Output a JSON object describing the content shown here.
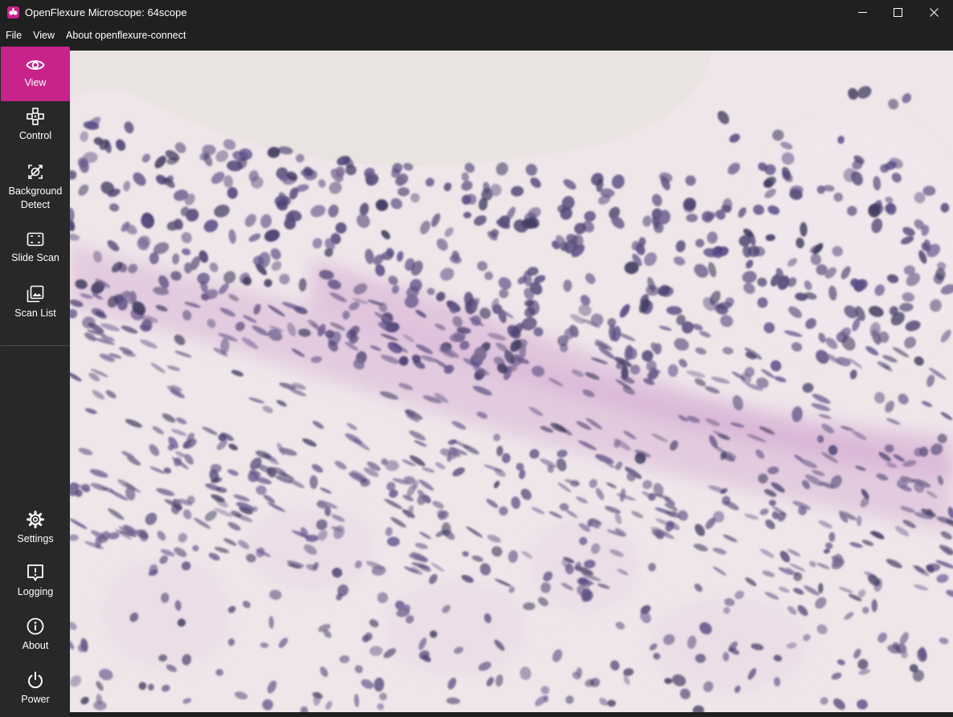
{
  "window": {
    "title": "OpenFlexure Microscope: 64scope",
    "app_icon": "openflexure-logo-icon",
    "controls": [
      "minimize-icon",
      "maximize-icon",
      "close-icon"
    ]
  },
  "menu": [
    "File",
    "View",
    "About openflexure-connect"
  ],
  "sidebar": {
    "top_items": [
      {
        "label": "View",
        "icon": "eye-icon",
        "active": true
      },
      {
        "label": "Control",
        "icon": "gamepad-icon",
        "active": false
      },
      {
        "label": "Background Detect",
        "icon": "background-detect-icon",
        "active": false
      },
      {
        "label": "Slide Scan",
        "icon": "scan-frame-icon",
        "active": false
      },
      {
        "label": "Scan List",
        "icon": "image-stack-icon",
        "active": false
      }
    ],
    "bottom_items": [
      {
        "label": "Settings",
        "icon": "gear-icon"
      },
      {
        "label": "Logging",
        "icon": "alert-box-icon"
      },
      {
        "label": "About",
        "icon": "info-icon"
      },
      {
        "label": "Power",
        "icon": "power-icon"
      }
    ]
  },
  "colors": {
    "accent": "#c7238a",
    "sidebar_bg": "#282828",
    "chrome_bg": "#202020",
    "specimen_bg": "#efe6ea",
    "nucleus": "#5a4f7c",
    "nucleus_dark": "#4a3f70",
    "stroma": "#d9b8d6"
  },
  "viewer": {
    "content": "live-camera-feed"
  }
}
